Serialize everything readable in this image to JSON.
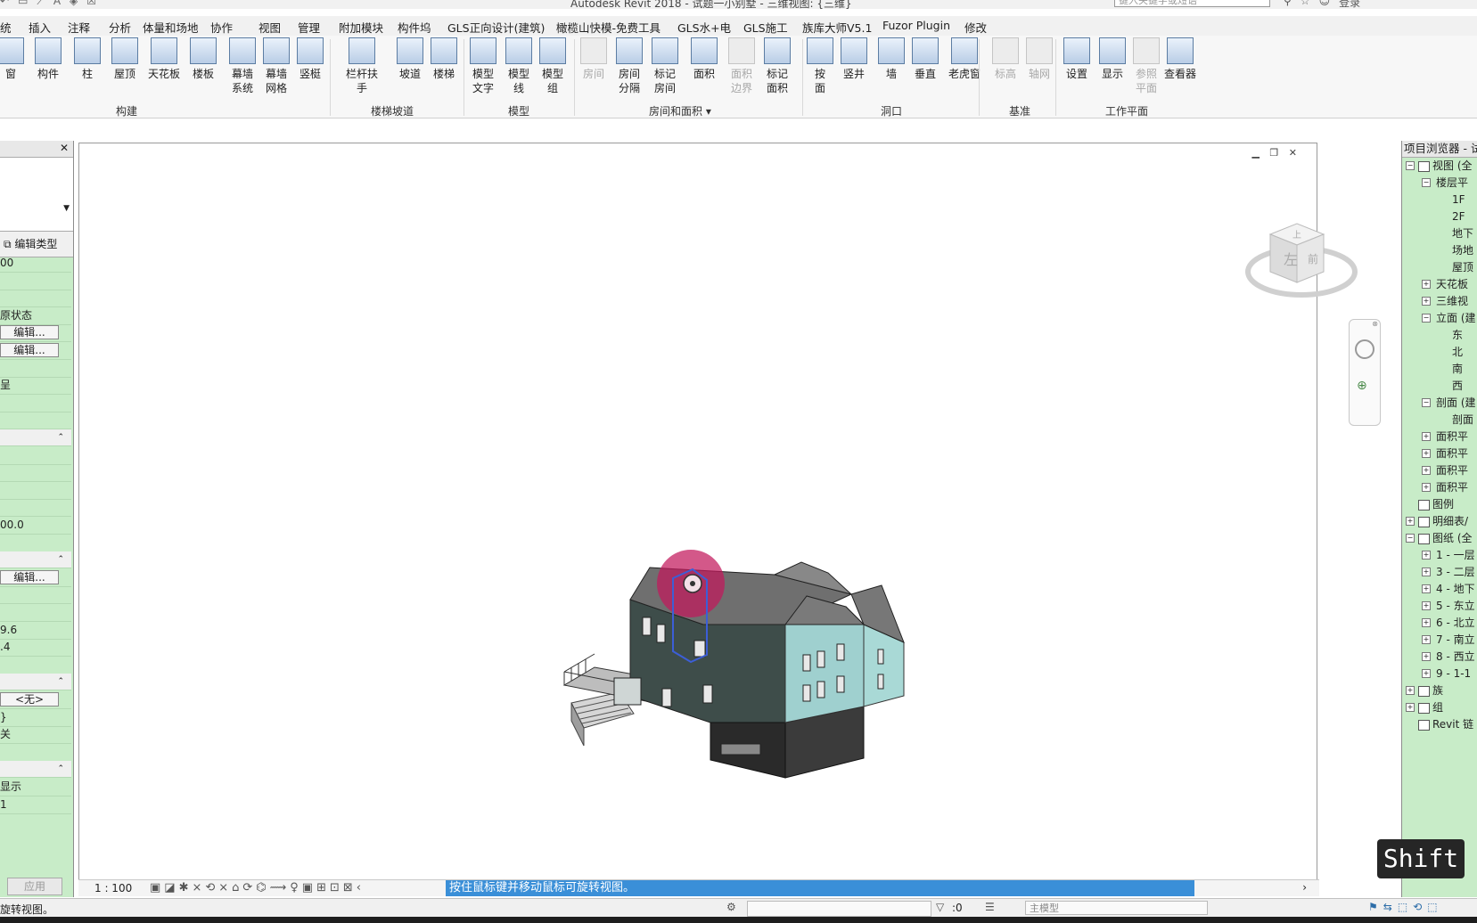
{
  "window": {
    "title": "Autodesk Revit 2018 -    试题一小别墅 - 三维视图: {三维}",
    "search_placeholder": "键入关键字或短语",
    "login_label": "登录"
  },
  "menu_tabs": [
    "统",
    "插入",
    "注释",
    "分析",
    "体量和场地",
    "协作",
    "视图",
    "管理",
    "附加模块",
    "构件坞",
    "GLS正向设计(建筑)",
    "橄榄山快模-免费工具",
    "GLS水+电",
    "GLS施工",
    "族库大师V5.1",
    "Fuzor Plugin",
    "修改"
  ],
  "ribbon": {
    "buttons": [
      {
        "label": "窗"
      },
      {
        "label": "构件"
      },
      {
        "label": "柱"
      },
      {
        "label": "屋顶"
      },
      {
        "label": "天花板"
      },
      {
        "label": "楼板"
      },
      {
        "label": "幕墙\n系统"
      },
      {
        "label": "幕墙\n网格"
      },
      {
        "label": "竖梃"
      },
      {
        "label": "栏杆扶手"
      },
      {
        "label": "坡道"
      },
      {
        "label": "楼梯"
      },
      {
        "label": "模型\n文字"
      },
      {
        "label": "模型\n线"
      },
      {
        "label": "模型\n组"
      },
      {
        "label": "房间",
        "disabled": true
      },
      {
        "label": "房间\n分隔"
      },
      {
        "label": "标记\n房间"
      },
      {
        "label": "面积"
      },
      {
        "label": "面积\n边界",
        "disabled": true
      },
      {
        "label": "标记\n面积"
      },
      {
        "label": "按\n面"
      },
      {
        "label": "竖井"
      },
      {
        "label": "墙"
      },
      {
        "label": "垂直"
      },
      {
        "label": "老虎窗"
      },
      {
        "label": "标高",
        "disabled": true
      },
      {
        "label": "轴网",
        "disabled": true
      },
      {
        "label": "设置"
      },
      {
        "label": "显示"
      },
      {
        "label": "参照\n平面",
        "disabled": true
      },
      {
        "label": "查看器"
      }
    ],
    "panels": [
      "构建",
      "楼梯坡道",
      "模型",
      "房间和面积 ▾",
      "洞口",
      "基准",
      "工作平面"
    ]
  },
  "properties": {
    "edit_type_label": "编辑类型",
    "rows": [
      {
        "text": "00"
      },
      {
        "text": ""
      },
      {
        "text": ""
      },
      {
        "text": "原状态"
      },
      {
        "text": "编辑...",
        "button": true
      },
      {
        "text": "编辑...",
        "button": true
      },
      {
        "text": ""
      },
      {
        "text": "呈"
      },
      {
        "text": ""
      },
      {
        "text": ""
      },
      {
        "text": "",
        "group": true
      },
      {
        "text": ""
      },
      {
        "text": ""
      },
      {
        "text": ""
      },
      {
        "text": ""
      },
      {
        "text": "00.0"
      },
      {
        "text": ""
      },
      {
        "text": "",
        "group": true
      },
      {
        "text": "编辑...",
        "button": true
      },
      {
        "text": ""
      },
      {
        "text": ""
      },
      {
        "text": "9.6"
      },
      {
        "text": ".4"
      },
      {
        "text": ""
      },
      {
        "text": "",
        "group": true
      },
      {
        "text": "<无>",
        "button": true
      },
      {
        "text": "}"
      },
      {
        "text": "关"
      },
      {
        "text": ""
      },
      {
        "text": "",
        "group": true
      },
      {
        "text": "显示"
      },
      {
        "text": "1"
      }
    ],
    "apply_label": "应用"
  },
  "view": {
    "scale": "1 : 100",
    "hint": "按住鼠标键并移动鼠标可旋转视图。"
  },
  "viewcube": {
    "face_left": "左",
    "face_front": "前",
    "face_top": "上"
  },
  "browser": {
    "title": "项目浏览器 - 试",
    "nodes": [
      {
        "label": "视图 (全",
        "depth": 0,
        "toggle": "−",
        "icon": true
      },
      {
        "label": "楼层平",
        "depth": 1,
        "toggle": "−"
      },
      {
        "label": "1F",
        "depth": 2
      },
      {
        "label": "2F",
        "depth": 2
      },
      {
        "label": "地下",
        "depth": 2
      },
      {
        "label": "场地",
        "depth": 2
      },
      {
        "label": "屋顶",
        "depth": 2
      },
      {
        "label": "天花板",
        "depth": 1,
        "toggle": "+"
      },
      {
        "label": "三维视",
        "depth": 1,
        "toggle": "+"
      },
      {
        "label": "立面 (建",
        "depth": 1,
        "toggle": "−"
      },
      {
        "label": "东",
        "depth": 2
      },
      {
        "label": "北",
        "depth": 2
      },
      {
        "label": "南",
        "depth": 2
      },
      {
        "label": "西",
        "depth": 2
      },
      {
        "label": "剖面 (建",
        "depth": 1,
        "toggle": "−"
      },
      {
        "label": "剖面",
        "depth": 2
      },
      {
        "label": "面积平",
        "depth": 1,
        "toggle": "+"
      },
      {
        "label": "面积平",
        "depth": 1,
        "toggle": "+"
      },
      {
        "label": "面积平",
        "depth": 1,
        "toggle": "+"
      },
      {
        "label": "面积平",
        "depth": 1,
        "toggle": "+"
      },
      {
        "label": "图例",
        "depth": 0,
        "icon": true
      },
      {
        "label": "明细表/",
        "depth": 0,
        "toggle": "+",
        "icon": true
      },
      {
        "label": "图纸 (全",
        "depth": 0,
        "toggle": "−",
        "icon": true
      },
      {
        "label": "1 - 一层",
        "depth": 1,
        "toggle": "+"
      },
      {
        "label": "3 - 二层",
        "depth": 1,
        "toggle": "+"
      },
      {
        "label": "4 - 地下",
        "depth": 1,
        "toggle": "+"
      },
      {
        "label": "5 - 东立",
        "depth": 1,
        "toggle": "+"
      },
      {
        "label": "6 - 北立",
        "depth": 1,
        "toggle": "+"
      },
      {
        "label": "7 - 南立",
        "depth": 1,
        "toggle": "+"
      },
      {
        "label": "8 - 西立",
        "depth": 1,
        "toggle": "+"
      },
      {
        "label": "9 - 1-1",
        "depth": 1,
        "toggle": "+"
      },
      {
        "label": "族",
        "depth": 0,
        "toggle": "+",
        "icon": true
      },
      {
        "label": "组",
        "depth": 0,
        "toggle": "+",
        "icon": true
      },
      {
        "label": "Revit 链",
        "depth": 0,
        "icon": true
      }
    ]
  },
  "status": {
    "message": "旋转视图。",
    "selection_count": ":0",
    "workset": "主模型"
  },
  "shift_key": "Shift"
}
